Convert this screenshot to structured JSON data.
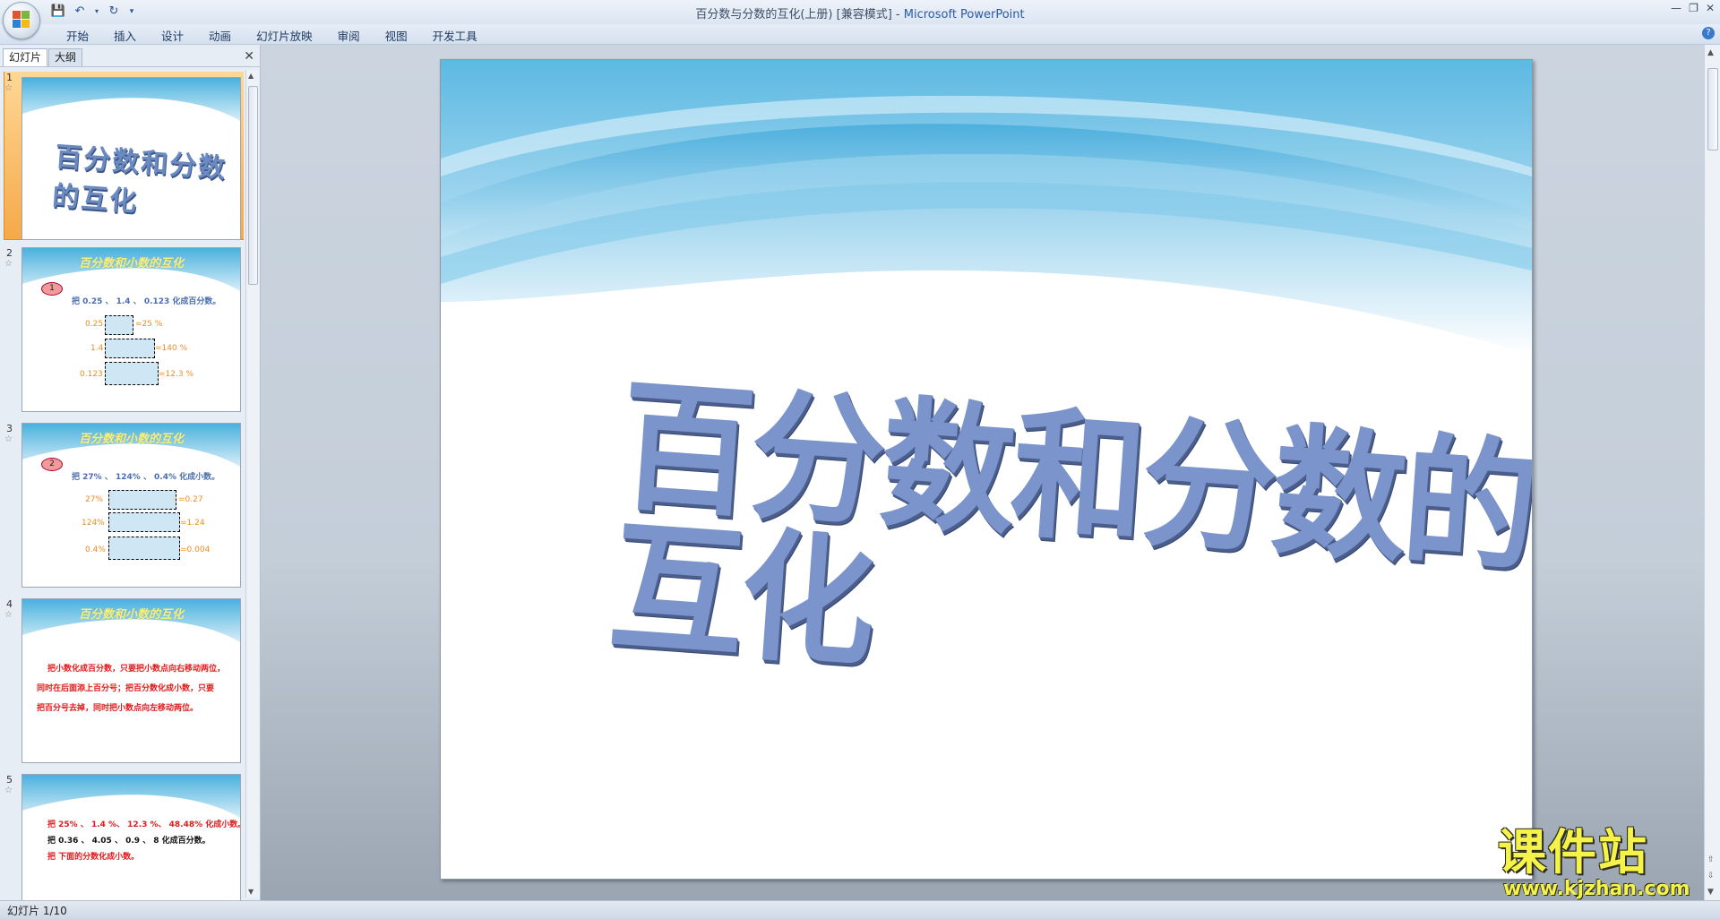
{
  "window": {
    "title": "百分数与分数的互化(上册) [兼容模式]",
    "app_name": "Microsoft PowerPoint",
    "separator": " - "
  },
  "ribbon": {
    "tabs": [
      "开始",
      "插入",
      "设计",
      "动画",
      "幻灯片放映",
      "审阅",
      "视图",
      "开发工具"
    ]
  },
  "left_pane": {
    "tabs": [
      "幻灯片",
      "大纲"
    ],
    "slides": [
      {
        "num": "1",
        "title": "百分数和分数的互化"
      },
      {
        "num": "2",
        "header": "百分数和小数的互化",
        "badge": "1",
        "instruction": "把 0.25 、 1.4 、 0.123  化成百分数。",
        "rows": [
          {
            "left": "0.25",
            "right": "=25 %"
          },
          {
            "left": "1.4",
            "right": "=140 %"
          },
          {
            "left": "0.123",
            "right": "=12.3  %"
          }
        ]
      },
      {
        "num": "3",
        "header": "百分数和小数的互化",
        "badge": "2",
        "instruction": "把 27% 、 124% 、 0.4%  化成小数。",
        "rows": [
          {
            "left": "27%",
            "right": "=0.27"
          },
          {
            "left": "124%",
            "right": "=1.24"
          },
          {
            "left": "0.4%",
            "right": "=0.004"
          }
        ]
      },
      {
        "num": "4",
        "header": "百分数和小数的互化",
        "lines": [
          "把小数化成百分数，只要把小数点向右移动两位，",
          "同时在后面添上百分号；把百分数化成小数，只要",
          "把百分号去掉，同时把小数点向左移动两位。"
        ]
      },
      {
        "num": "5",
        "lines": [
          "把 25% 、 1.4 %、 12.3 %、 48.48% 化成小数。",
          "把 0.36 、 4.05 、 0.9 、 8 化成百分数。",
          "把 下面的分数化成小数。"
        ]
      }
    ]
  },
  "slide": {
    "title": "百分数和分数的互化"
  },
  "status_bar": {
    "slide_indicator": "幻灯片 1/10"
  },
  "watermark": {
    "name": "课件站",
    "url": "www.kjzhan.com"
  },
  "colors": {
    "title_text": "#7b95cc",
    "selection": "#f5a949",
    "thumb_orange": "#f08c1d",
    "thumb_red": "#e41a1a"
  }
}
